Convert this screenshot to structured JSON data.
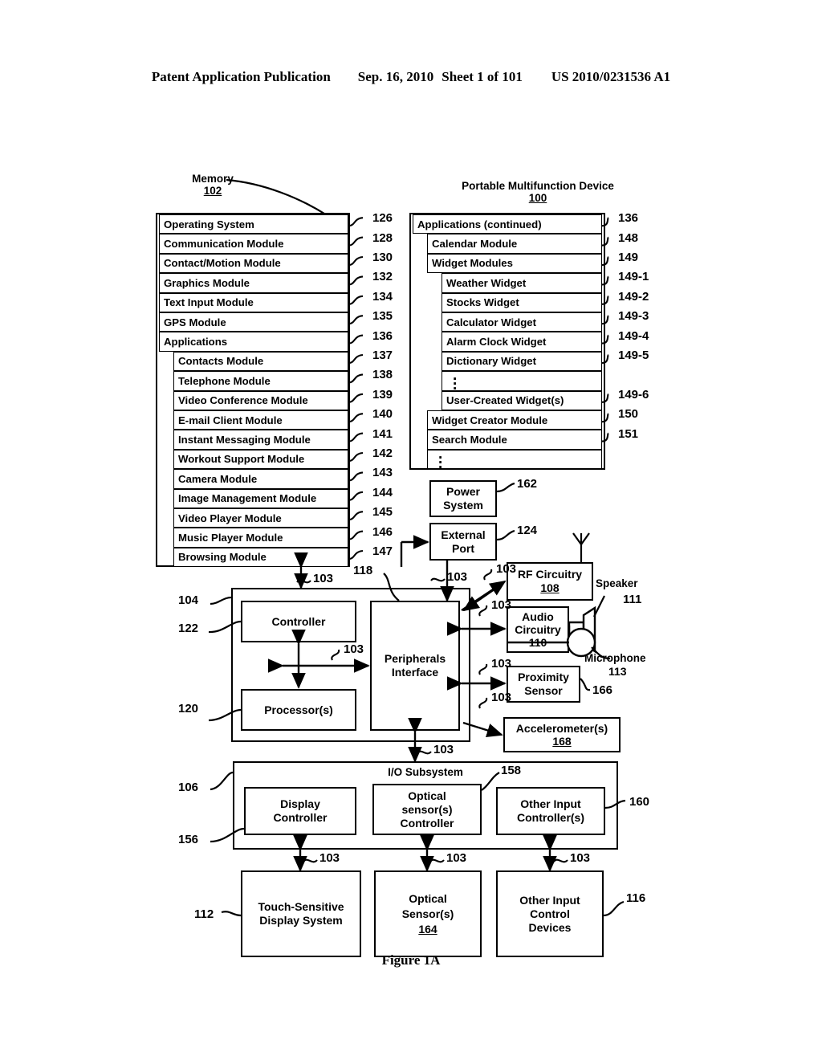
{
  "header": {
    "publication": "Patent Application Publication",
    "date": "Sep. 16, 2010",
    "sheet": "Sheet 1 of 101",
    "number": "US 2010/0231536 A1"
  },
  "figure_caption": "Figure 1A",
  "memory": {
    "title": "Memory",
    "ref": "102",
    "rows": [
      {
        "label": "Operating System",
        "ref": "126",
        "indent": 0
      },
      {
        "label": "Communication Module",
        "ref": "128",
        "indent": 0
      },
      {
        "label": "Contact/Motion Module",
        "ref": "130",
        "indent": 0
      },
      {
        "label": "Graphics Module",
        "ref": "132",
        "indent": 0
      },
      {
        "label": "Text Input Module",
        "ref": "134",
        "indent": 0
      },
      {
        "label": "GPS Module",
        "ref": "135",
        "indent": 0
      },
      {
        "label": "Applications",
        "ref": "136",
        "indent": 0
      },
      {
        "label": "Contacts Module",
        "ref": "137",
        "indent": 1
      },
      {
        "label": "Telephone Module",
        "ref": "138",
        "indent": 1
      },
      {
        "label": "Video Conference Module",
        "ref": "139",
        "indent": 1
      },
      {
        "label": "E-mail Client Module",
        "ref": "140",
        "indent": 1
      },
      {
        "label": "Instant Messaging Module",
        "ref": "141",
        "indent": 1
      },
      {
        "label": "Workout Support Module",
        "ref": "142",
        "indent": 1
      },
      {
        "label": "Camera Module",
        "ref": "143",
        "indent": 1
      },
      {
        "label": "Image Management Module",
        "ref": "144",
        "indent": 1
      },
      {
        "label": "Video Player Module",
        "ref": "145",
        "indent": 1
      },
      {
        "label": "Music Player Module",
        "ref": "146",
        "indent": 1
      },
      {
        "label": "Browsing Module",
        "ref": "147",
        "indent": 1
      }
    ]
  },
  "device": {
    "title": "Portable Multifunction Device",
    "ref": "100",
    "rows": [
      {
        "label": "Applications (continued)",
        "ref": "136",
        "indent": 0
      },
      {
        "label": "Calendar Module",
        "ref": "148",
        "indent": 1
      },
      {
        "label": "Widget Modules",
        "ref": "149",
        "indent": 1
      },
      {
        "label": "Weather Widget",
        "ref": "149-1",
        "indent": 2
      },
      {
        "label": "Stocks Widget",
        "ref": "149-2",
        "indent": 2
      },
      {
        "label": "Calculator Widget",
        "ref": "149-3",
        "indent": 2
      },
      {
        "label": "Alarm Clock Widget",
        "ref": "149-4",
        "indent": 2
      },
      {
        "label": "Dictionary Widget",
        "ref": "149-5",
        "indent": 2
      },
      {
        "label": "",
        "ref": "",
        "indent": 2,
        "ellipsis": true
      },
      {
        "label": "User-Created Widget(s)",
        "ref": "149-6",
        "indent": 2
      },
      {
        "label": "Widget Creator Module",
        "ref": "150",
        "indent": 1
      },
      {
        "label": "Search Module",
        "ref": "151",
        "indent": 1
      },
      {
        "label": "",
        "ref": "",
        "indent": 1,
        "ellipsis": true
      }
    ]
  },
  "blocks": {
    "power_system": {
      "label": "Power\nSystem",
      "ref": "162"
    },
    "external_port": {
      "label": "External\nPort",
      "ref": "124"
    },
    "rf_circuitry": {
      "label": "RF Circuitry",
      "ref": "108"
    },
    "audio_circuitry": {
      "label": "Audio\nCircuitry",
      "ref": "110"
    },
    "proximity_sensor": {
      "label": "Proximity\nSensor",
      "ref": "166"
    },
    "accelerometers": {
      "label": "Accelerometer(s)",
      "ref": "168"
    },
    "controller": {
      "label": "Controller",
      "ref": "122"
    },
    "processors": {
      "label": "Processor(s)",
      "ref": "120"
    },
    "peripherals_interface": {
      "label": "Peripherals\nInterface",
      "ref": "118"
    },
    "cpu_outer_ref": "104",
    "io_subsystem": {
      "label": "I/O Subsystem",
      "ref": "106"
    },
    "display_controller": {
      "label": "Display\nController",
      "ref": "156"
    },
    "optical_sensor_controller": {
      "label": "Optical\nsensor(s)\nController",
      "ref": "158"
    },
    "other_input_controllers": {
      "label": "Other Input\nController(s)",
      "ref": "160"
    },
    "touch_display": {
      "label": "Touch-Sensitive\nDisplay System",
      "ref": "112"
    },
    "optical_sensors": {
      "label": "Optical\nSensor(s)",
      "ref": "164"
    },
    "other_input_devices": {
      "label": "Other Input\nControl\nDevices",
      "ref": "116"
    },
    "speaker": {
      "label": "Speaker",
      "ref": "111"
    },
    "microphone": {
      "label": "Microphone",
      "ref": "113"
    }
  },
  "bus_label": "103",
  "bus_labels_count": 11,
  "colors": {
    "ink": "#000000",
    "paper": "#ffffff"
  }
}
